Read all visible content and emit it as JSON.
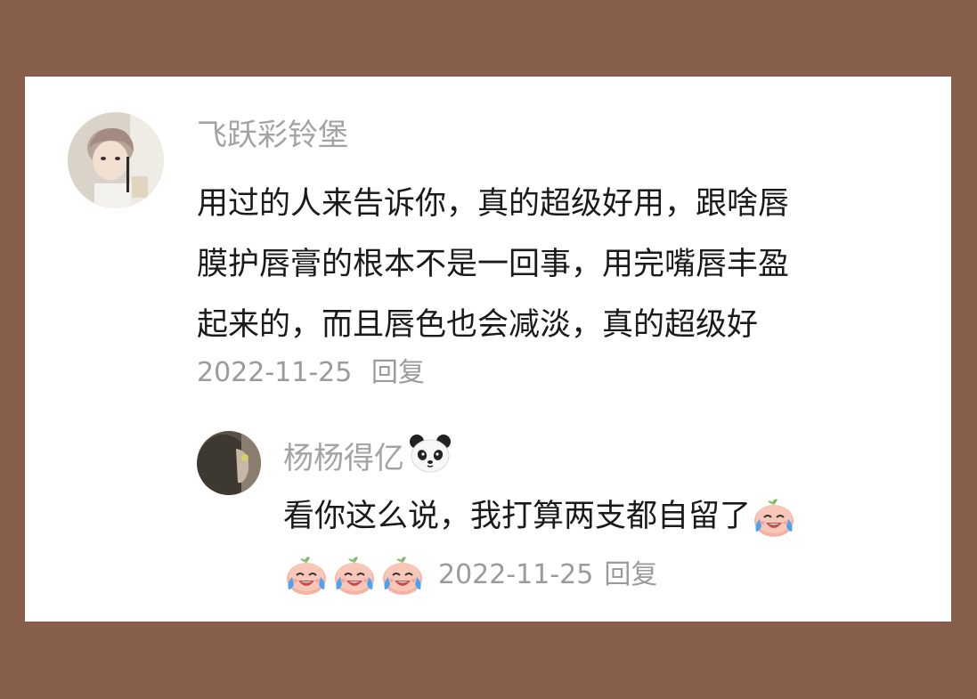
{
  "comment": {
    "username": "飞跃彩铃堡",
    "lines": [
      "用过的人来告诉你，真的超级好用，跟啥唇",
      "膜护唇膏的根本不是一回事，用完嘴唇丰盈",
      "起来的，而且唇色也会减淡，真的超级好"
    ],
    "date": "2022-11-25",
    "reply_label": "回复"
  },
  "reply": {
    "username": "杨杨得亿",
    "text": "看你这么说，我打算两支都自留了",
    "date": "2022-11-25",
    "reply_label": "回复",
    "emojis": [
      "crying-laugh-emoji",
      "crying-laugh-emoji",
      "crying-laugh-emoji",
      "crying-laugh-emoji"
    ],
    "username_emoji": "panda-emoji"
  },
  "colors": {
    "background": "#875d4b",
    "card": "#ffffff",
    "username": "#a3a3a3",
    "text": "#1a1a1a",
    "meta": "#9b9b9b"
  }
}
